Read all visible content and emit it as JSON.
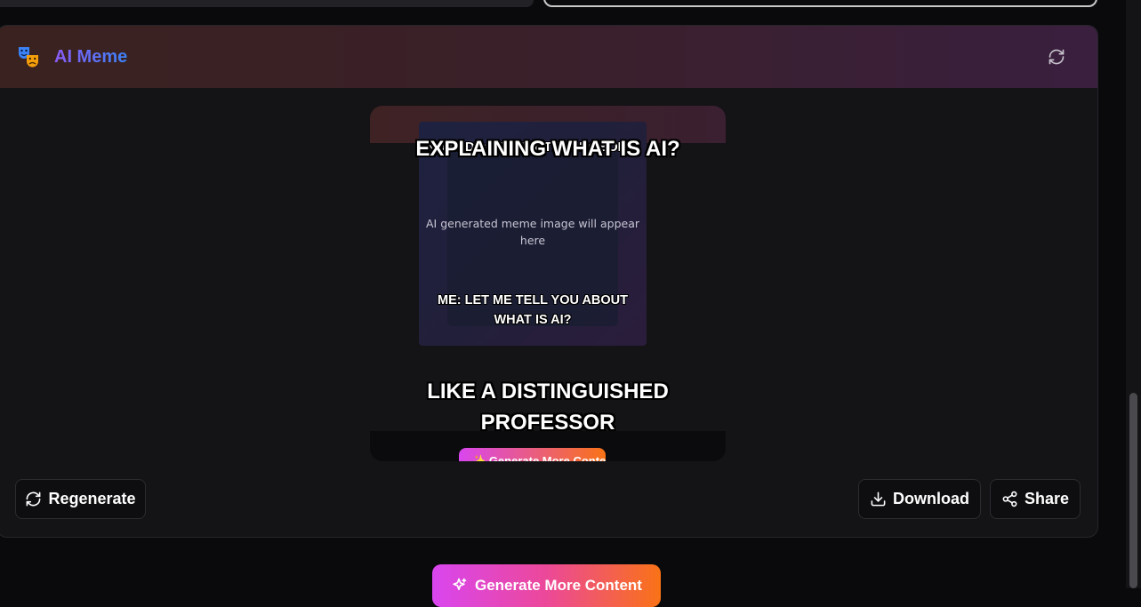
{
  "header": {
    "title": "AI Meme",
    "icon": "theater-masks-icon",
    "refresh_icon": "refresh-icon"
  },
  "meme": {
    "top_text": "EXPLAINING WHAT IS AI?",
    "bottom_text": "LIKE A DISTINGUISHED PROFESSOR",
    "inner_top_text": "NOBODY: ABSOLUTELY NOBODY:",
    "inner_bottom_text": "ME: LET ME TELL YOU ABOUT WHAT IS AI?",
    "placeholder": "AI generated meme image will appear here",
    "preview_generate_label": "Generate More Content"
  },
  "actions": {
    "regenerate_label": "Regenerate",
    "download_label": "Download",
    "share_label": "Share"
  },
  "footer": {
    "generate_more_label": "Generate More Content"
  },
  "colors": {
    "accent_start": "#d946ef",
    "accent_end": "#f97316",
    "title_gradient_start": "#8b5cf6",
    "title_gradient_end": "#3b82f6"
  }
}
